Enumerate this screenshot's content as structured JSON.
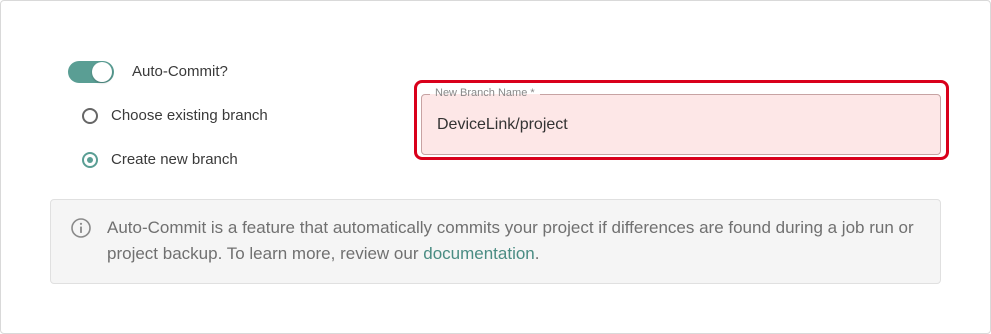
{
  "auto_commit": {
    "label": "Auto-Commit?",
    "enabled": true
  },
  "branch_mode": {
    "options": [
      {
        "label": "Choose existing branch",
        "selected": false
      },
      {
        "label": "Create new branch",
        "selected": true
      }
    ]
  },
  "new_branch": {
    "label": "New Branch Name",
    "required_marker": "*",
    "value": "DeviceLink/project"
  },
  "info": {
    "text_before": "Auto-Commit is a feature that automatically commits your project if differences are found during a job run or project backup. To learn more, review our ",
    "link_text": "documentation",
    "text_after": ".",
    "icon": "info-circle-icon"
  },
  "colors": {
    "accent": "#5a9e94",
    "error_highlight": "#d9001b",
    "field_background": "#fde7e7",
    "link": "#4a8c83"
  }
}
